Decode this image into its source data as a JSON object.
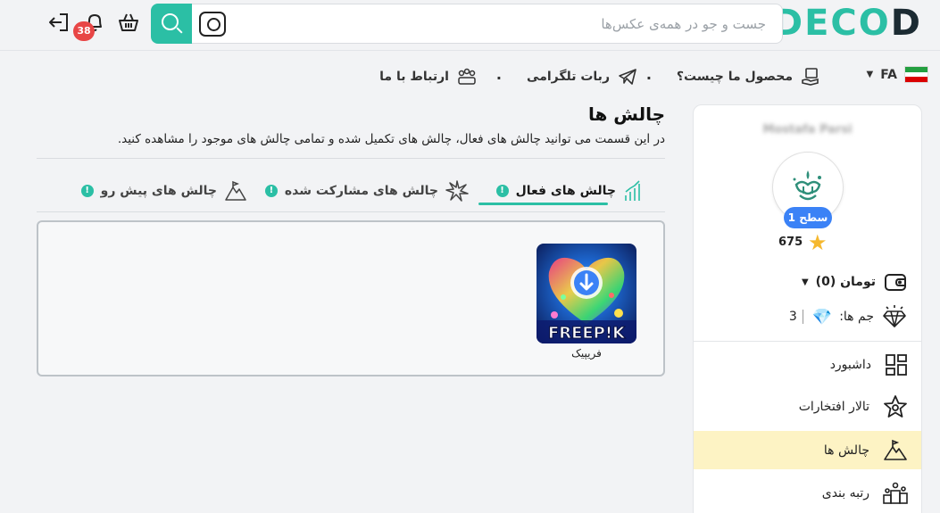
{
  "header": {
    "brand": {
      "part1": "DECO",
      "part2": "D"
    },
    "search": {
      "placeholder": "جست و جو در همه‌ی عکس‌ها",
      "value": ""
    },
    "notifications_count": "38",
    "icons": [
      "logout-icon",
      "bell-icon",
      "cart-icon",
      "search-icon",
      "camera-icon"
    ]
  },
  "nav": {
    "language": "FA",
    "items": [
      {
        "label": "محصول ما چیست؟",
        "icon": "box-hand-icon"
      },
      {
        "label": "ربات تلگرامی",
        "icon": "telegram-icon"
      },
      {
        "label": "ارتباط با ما",
        "icon": "people-icon"
      }
    ],
    "separator": "."
  },
  "sidebar": {
    "user_name": "Mostafa Parsi",
    "level_label": "سطح 1",
    "score": "675",
    "wallet_label": "تومان (0)",
    "gems_label": "جم ها:",
    "gems_count": "3",
    "menu": [
      {
        "label": "داشبورد",
        "icon": "dashboard-icon"
      },
      {
        "label": "تالار افتخارات",
        "icon": "star-outline-icon"
      },
      {
        "label": "چالش ها",
        "icon": "mountain-icon",
        "active": true
      },
      {
        "label": "رتبه بندی",
        "icon": "ranking-icon"
      }
    ]
  },
  "main": {
    "title": "چالش ها",
    "description": "در این قسمت می توانید چالش های فعال، چالش های تکمیل شده و تمامی چالش های موجود را مشاهده کنید.",
    "tabs": [
      {
        "label": "چالش های فعال",
        "active": true
      },
      {
        "label": "چالش های مشارکت شده",
        "active": false
      },
      {
        "label": "چالش های پیش رو",
        "active": false
      }
    ],
    "cards": [
      {
        "label": "فریپیک",
        "thumb_text": "FREEP!K"
      }
    ]
  },
  "colors": {
    "accent": "#2bbfa5",
    "badge": "#e84646",
    "level": "#3b82f6",
    "active_menu": "#fdf3c4",
    "star": "#f5b82e"
  }
}
